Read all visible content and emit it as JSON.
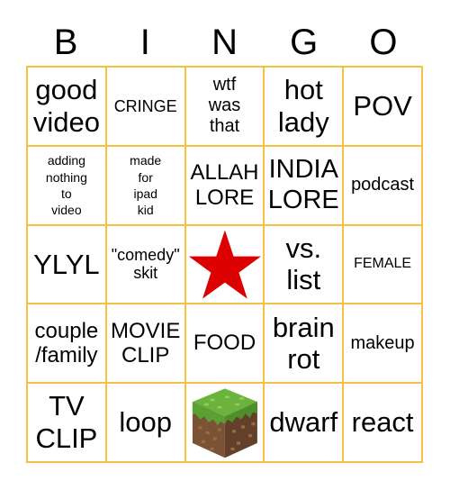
{
  "header": {
    "letters": [
      "B",
      "I",
      "N",
      "G",
      "O"
    ]
  },
  "colors": {
    "grid_line": "#f5c142",
    "star": "#dd0000"
  },
  "cells": [
    {
      "text": "good\nvideo",
      "size": "xl"
    },
    {
      "text": "CRINGE",
      "size": "sm"
    },
    {
      "text": "wtf\nwas\nthat",
      "size": "md"
    },
    {
      "text": "hot\nlady",
      "size": "xl"
    },
    {
      "text": "POV",
      "size": "xl"
    },
    {
      "text": "adding\nnothing\nto\nvideo",
      "size": "xxs"
    },
    {
      "text": "made\nfor\nipad\nkid",
      "size": "xxs"
    },
    {
      "text": "ALLAH\nLORE",
      "size": "ml"
    },
    {
      "text": "INDIA\nLORE",
      "size": "lg"
    },
    {
      "text": "podcast",
      "size": "md"
    },
    {
      "text": "YLYL",
      "size": "xl"
    },
    {
      "text": "\"comedy\"\nskit",
      "size": "sm"
    },
    {
      "icon": "red-star-icon",
      "text": ""
    },
    {
      "text": "vs.\nlist",
      "size": "xl"
    },
    {
      "text": "FEMALE",
      "size": "xs"
    },
    {
      "text": "couple\n/family",
      "size": "ml"
    },
    {
      "text": "MOVIE\nCLIP",
      "size": "ml"
    },
    {
      "text": "FOOD",
      "size": "ml"
    },
    {
      "text": "brain\nrot",
      "size": "xl"
    },
    {
      "text": "makeup",
      "size": "md"
    },
    {
      "text": "TV\nCLIP",
      "size": "xl"
    },
    {
      "text": "loop",
      "size": "xl"
    },
    {
      "icon": "grass-block-icon",
      "text": ""
    },
    {
      "text": "dwarf",
      "size": "xl"
    },
    {
      "text": "react",
      "size": "xl"
    }
  ]
}
